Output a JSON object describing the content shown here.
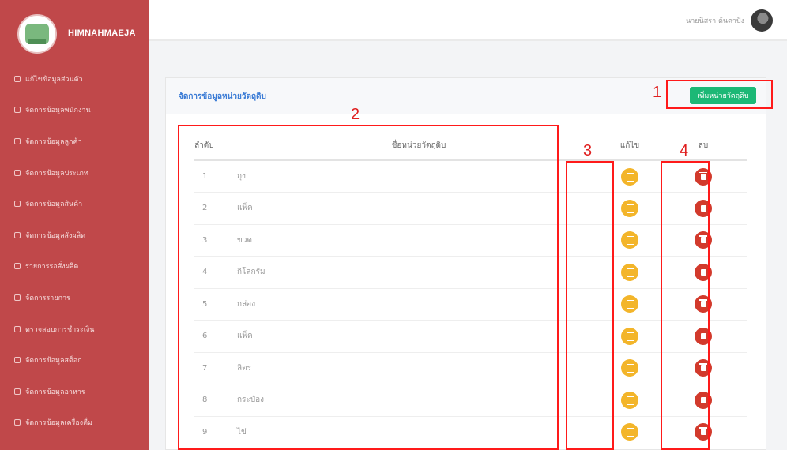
{
  "app": {
    "brand": "HIMNAHMAEJA"
  },
  "sidebar": {
    "items": [
      {
        "label": "แก้ไขข้อมูลส่วนตัว"
      },
      {
        "label": "จัดการข้อมูลพนักงาน"
      },
      {
        "label": "จัดการข้อมูลลูกค้า"
      },
      {
        "label": "จัดการข้อมูลประเภท"
      },
      {
        "label": "จัดการข้อมูลสินค้า"
      },
      {
        "label": "จัดการข้อมูลสั่งผลิต"
      },
      {
        "label": "รายการรอสั่งผลิต"
      },
      {
        "label": "จัดการรายการ"
      },
      {
        "label": "ตรวจสอบการชำระเงิน"
      },
      {
        "label": "จัดการข้อมูลสต็อก"
      },
      {
        "label": "จัดการข้อมูลอาหาร"
      },
      {
        "label": "จัดการข้อมูลเครื่องดื่ม"
      }
    ]
  },
  "topbar": {
    "username": "นายนิสรา ต้นตาปัง"
  },
  "card": {
    "title": "จัดการข้อมูลหน่วยวัตถุดิบ",
    "add_button": "เพิ่มหน่วยวัตถุดิบ"
  },
  "table": {
    "headers": {
      "no": "ลำดับ",
      "name": "ชื่อหน่วยวัตถุดิบ",
      "edit": "แก้ไข",
      "delete": "ลบ"
    },
    "rows": [
      {
        "no": "1",
        "name": "ถุง"
      },
      {
        "no": "2",
        "name": "แพ็ค"
      },
      {
        "no": "3",
        "name": "ขวด"
      },
      {
        "no": "4",
        "name": "กิโลกรัม"
      },
      {
        "no": "5",
        "name": "กล่อง"
      },
      {
        "no": "6",
        "name": "แพ็ค"
      },
      {
        "no": "7",
        "name": "ลิตร"
      },
      {
        "no": "8",
        "name": "กระป๋อง"
      },
      {
        "no": "9",
        "name": "ไข่"
      }
    ]
  },
  "annotations": {
    "n1": "1",
    "n2": "2",
    "n3": "3",
    "n4": "4"
  }
}
